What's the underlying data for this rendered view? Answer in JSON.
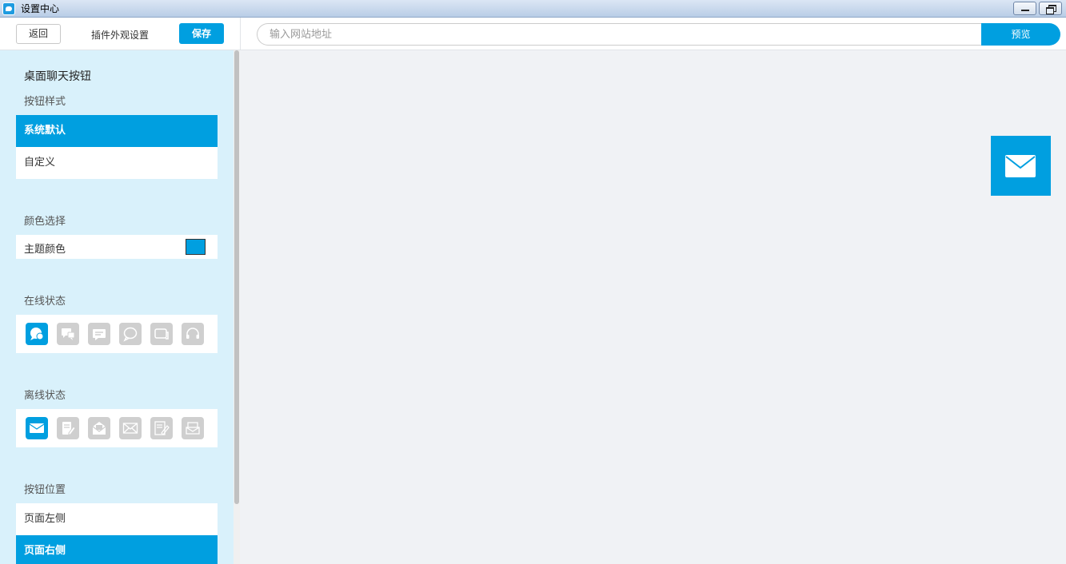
{
  "window": {
    "title": "设置中心"
  },
  "toolbar": {
    "back_label": "返回",
    "title": "插件外观设置",
    "save_label": "保存"
  },
  "preview_bar": {
    "url_placeholder": "输入网站地址",
    "url_value": "",
    "preview_label": "预览"
  },
  "sidebar": {
    "heading": "桌面聊天按钮",
    "button_style": {
      "label": "按钮样式",
      "options": [
        "系统默认",
        "自定义"
      ],
      "selected": "系统默认"
    },
    "color": {
      "label": "颜色选择",
      "theme_label": "主题颜色",
      "theme_value": "#009fe0"
    },
    "online": {
      "label": "在线状态",
      "icons": [
        "chat-bubble-icon",
        "chat-bubbles-icon",
        "message-lines-icon",
        "speech-bubble-outline-icon",
        "chat-box-outline-icon",
        "headset-icon"
      ],
      "selected": "chat-bubble-icon"
    },
    "offline": {
      "label": "离线状态",
      "icons": [
        "envelope-icon",
        "document-edit-icon",
        "envelope-open-icon",
        "envelope-outline-icon",
        "note-pencil-icon",
        "mail-tray-icon"
      ],
      "selected": "envelope-icon"
    },
    "position": {
      "label": "按钮位置",
      "options": [
        "页面左侧",
        "页面右侧"
      ],
      "selected": "页面右侧"
    }
  },
  "preview": {
    "float_button_icon": "envelope-icon"
  },
  "colors": {
    "accent": "#009fe0",
    "sidebar_bg": "#d9f1fb",
    "canvas_bg": "#f0f2f5",
    "inactive_icon": "#cfcfcf"
  }
}
